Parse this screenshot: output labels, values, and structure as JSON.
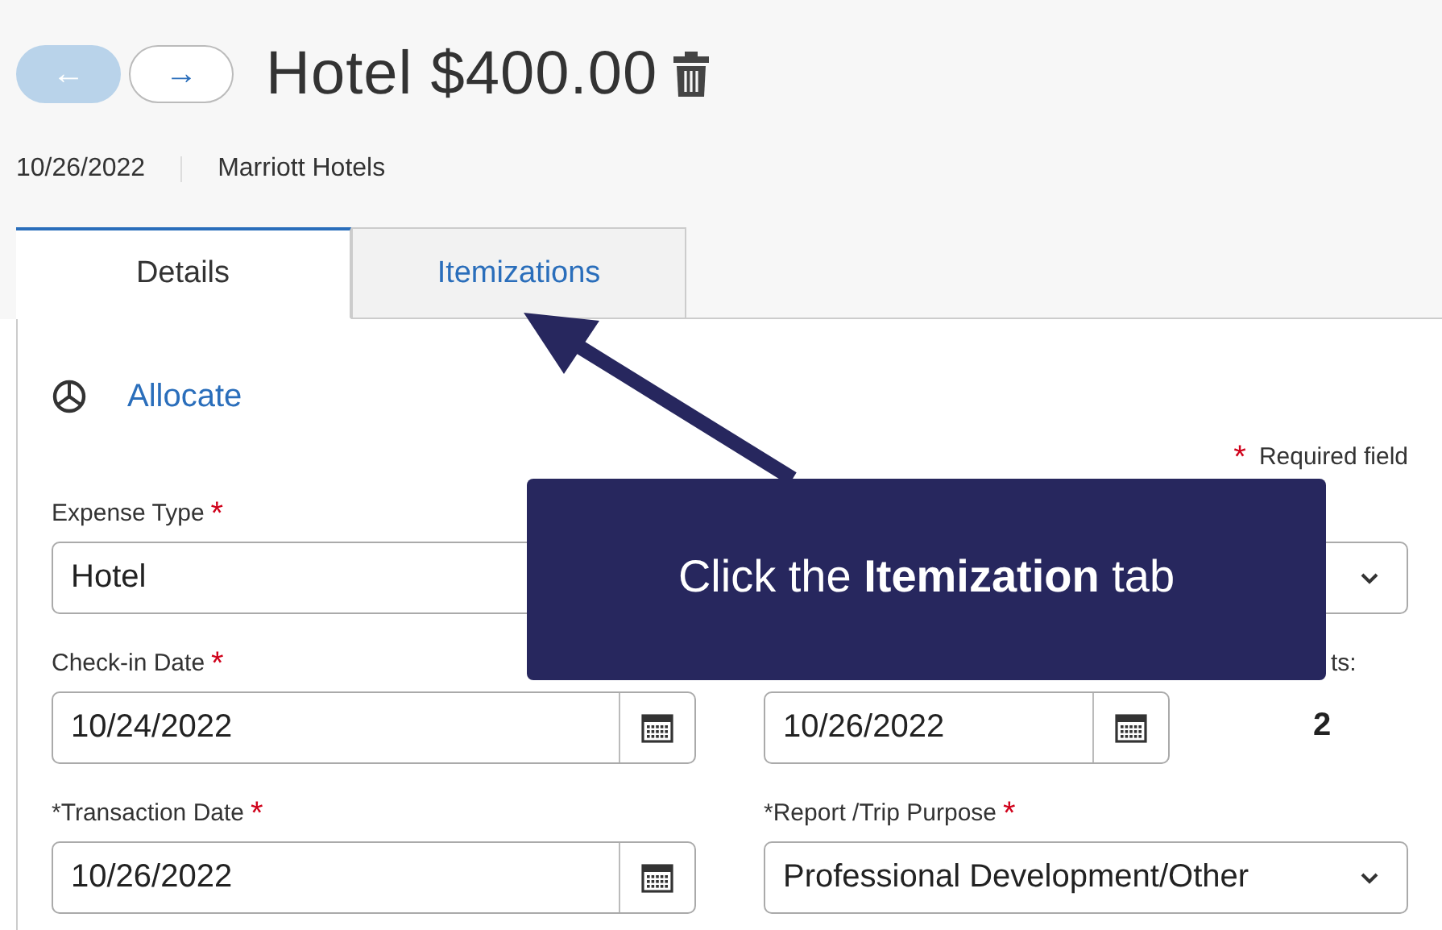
{
  "nav": [
    {
      "label": "←",
      "disabled": true
    },
    {
      "label": "→",
      "disabled": false
    }
  ],
  "title": "Hotel $400.00",
  "meta": {
    "date": "10/26/2022",
    "vendor": "Marriott Hotels"
  },
  "tabs": [
    {
      "label": "Details",
      "selected": true
    },
    {
      "label": "Itemizations",
      "selected": false
    }
  ],
  "allocate": {
    "label": "Allocate"
  },
  "required_note": {
    "mark": "*",
    "text": "Required field"
  },
  "form_rows": [
    [
      {
        "kind": "select",
        "label": "Expense Type",
        "required": true,
        "value": "Hotel"
      }
    ],
    [
      {
        "kind": "date",
        "label": "Check-in Date",
        "required": true,
        "value": "10/24/2022"
      },
      {
        "kind": "date",
        "value": "10/26/2022"
      },
      {
        "kind": "readout",
        "label": "ts:",
        "value": "2"
      }
    ],
    [
      {
        "kind": "date",
        "label": "*Transaction Date",
        "required": true,
        "value": "10/26/2022"
      },
      {
        "kind": "select",
        "label": "*Report /Trip Purpose",
        "required": true,
        "value": "Professional Development/Other"
      }
    ]
  ],
  "callout": {
    "text": "Click the **Itemization** tab"
  }
}
